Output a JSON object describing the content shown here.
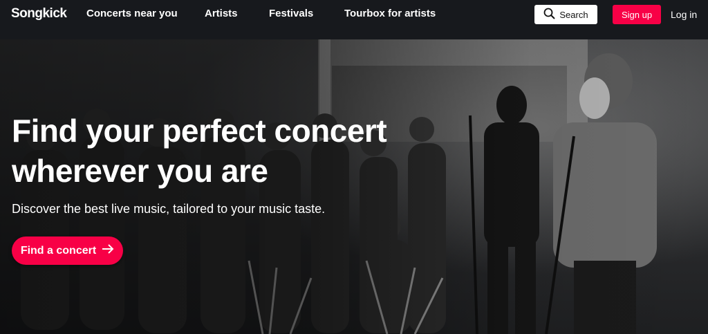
{
  "nav": {
    "logo": "Songkick",
    "links": [
      "Concerts near you",
      "Artists",
      "Festivals",
      "Tourbox for artists"
    ],
    "search_label": "Search",
    "signup_label": "Sign up",
    "login_label": "Log in"
  },
  "hero": {
    "headline_line1": "Find your perfect concert",
    "headline_line2": "wherever you are",
    "subtitle": "Discover the best live music, tailored to your music taste.",
    "cta_label": "Find a concert"
  },
  "colors": {
    "brand": "#f80046",
    "nav_bg": "#17191d"
  },
  "icons": [
    "search-icon",
    "arrow-right-icon"
  ]
}
